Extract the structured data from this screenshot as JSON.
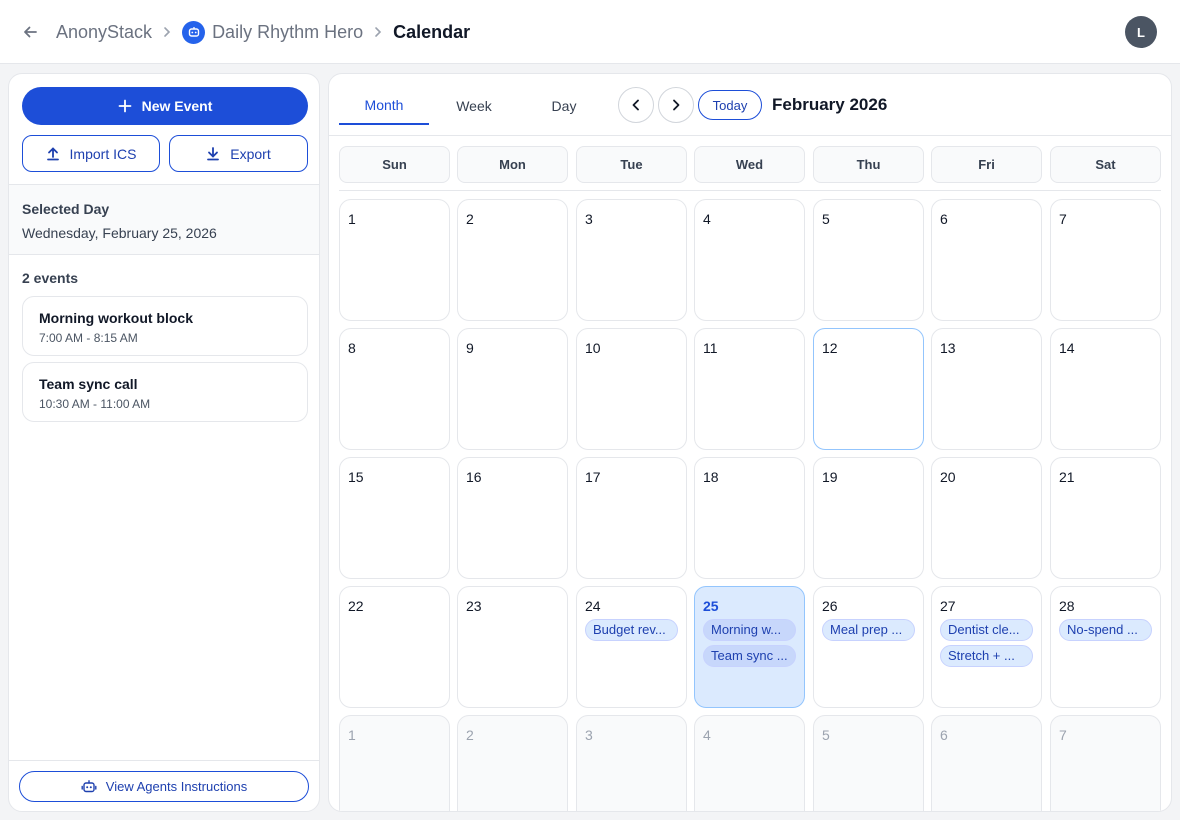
{
  "header": {
    "back_icon": "arrow-left-icon",
    "breadcrumb": {
      "org": "AnonyStack",
      "app": "Daily Rhythm Hero",
      "app_icon": "robot-icon",
      "page": "Calendar"
    },
    "avatar_initial": "L"
  },
  "sidebar": {
    "new_event": "New Event",
    "import_ics": "Import ICS",
    "export": "Export",
    "selected_day_label": "Selected Day",
    "selected_day_value": "Wednesday, February 25, 2026",
    "events_count": "2 events",
    "events": [
      {
        "title": "Morning workout block",
        "time": "7:00 AM - 8:15 AM"
      },
      {
        "title": "Team sync call",
        "time": "10:30 AM - 11:00 AM"
      }
    ],
    "agents_button": "View Agents Instructions"
  },
  "calendar": {
    "views": [
      "Month",
      "Week",
      "Day"
    ],
    "active_view": "Month",
    "today_label": "Today",
    "month_title": "February 2026",
    "weekdays": [
      "Sun",
      "Mon",
      "Tue",
      "Wed",
      "Thu",
      "Fri",
      "Sat"
    ],
    "weeks": [
      [
        {
          "day": "1"
        },
        {
          "day": "2"
        },
        {
          "day": "3"
        },
        {
          "day": "4"
        },
        {
          "day": "5"
        },
        {
          "day": "6"
        },
        {
          "day": "7"
        }
      ],
      [
        {
          "day": "8"
        },
        {
          "day": "9"
        },
        {
          "day": "10"
        },
        {
          "day": "11"
        },
        {
          "day": "12",
          "today": true
        },
        {
          "day": "13"
        },
        {
          "day": "14"
        }
      ],
      [
        {
          "day": "15"
        },
        {
          "day": "16"
        },
        {
          "day": "17"
        },
        {
          "day": "18"
        },
        {
          "day": "19"
        },
        {
          "day": "20"
        },
        {
          "day": "21"
        }
      ],
      [
        {
          "day": "22"
        },
        {
          "day": "23"
        },
        {
          "day": "24",
          "events": [
            "Budget rev..."
          ]
        },
        {
          "day": "25",
          "selected": true,
          "events": [
            "Morning w...",
            "Team sync ..."
          ]
        },
        {
          "day": "26",
          "events": [
            "Meal prep ..."
          ]
        },
        {
          "day": "27",
          "events": [
            "Dentist cle...",
            "Stretch + ..."
          ]
        },
        {
          "day": "28",
          "events": [
            "No-spend ..."
          ]
        }
      ],
      [
        {
          "day": "1",
          "outside": true
        },
        {
          "day": "2",
          "outside": true
        },
        {
          "day": "3",
          "outside": true
        },
        {
          "day": "4",
          "outside": true
        },
        {
          "day": "5",
          "outside": true
        },
        {
          "day": "6",
          "outside": true
        },
        {
          "day": "7",
          "outside": true
        }
      ]
    ]
  },
  "colors": {
    "accent": "#1d4ed8",
    "selected_bg": "#dbeafe",
    "avatar_bg": "#4b5563"
  }
}
